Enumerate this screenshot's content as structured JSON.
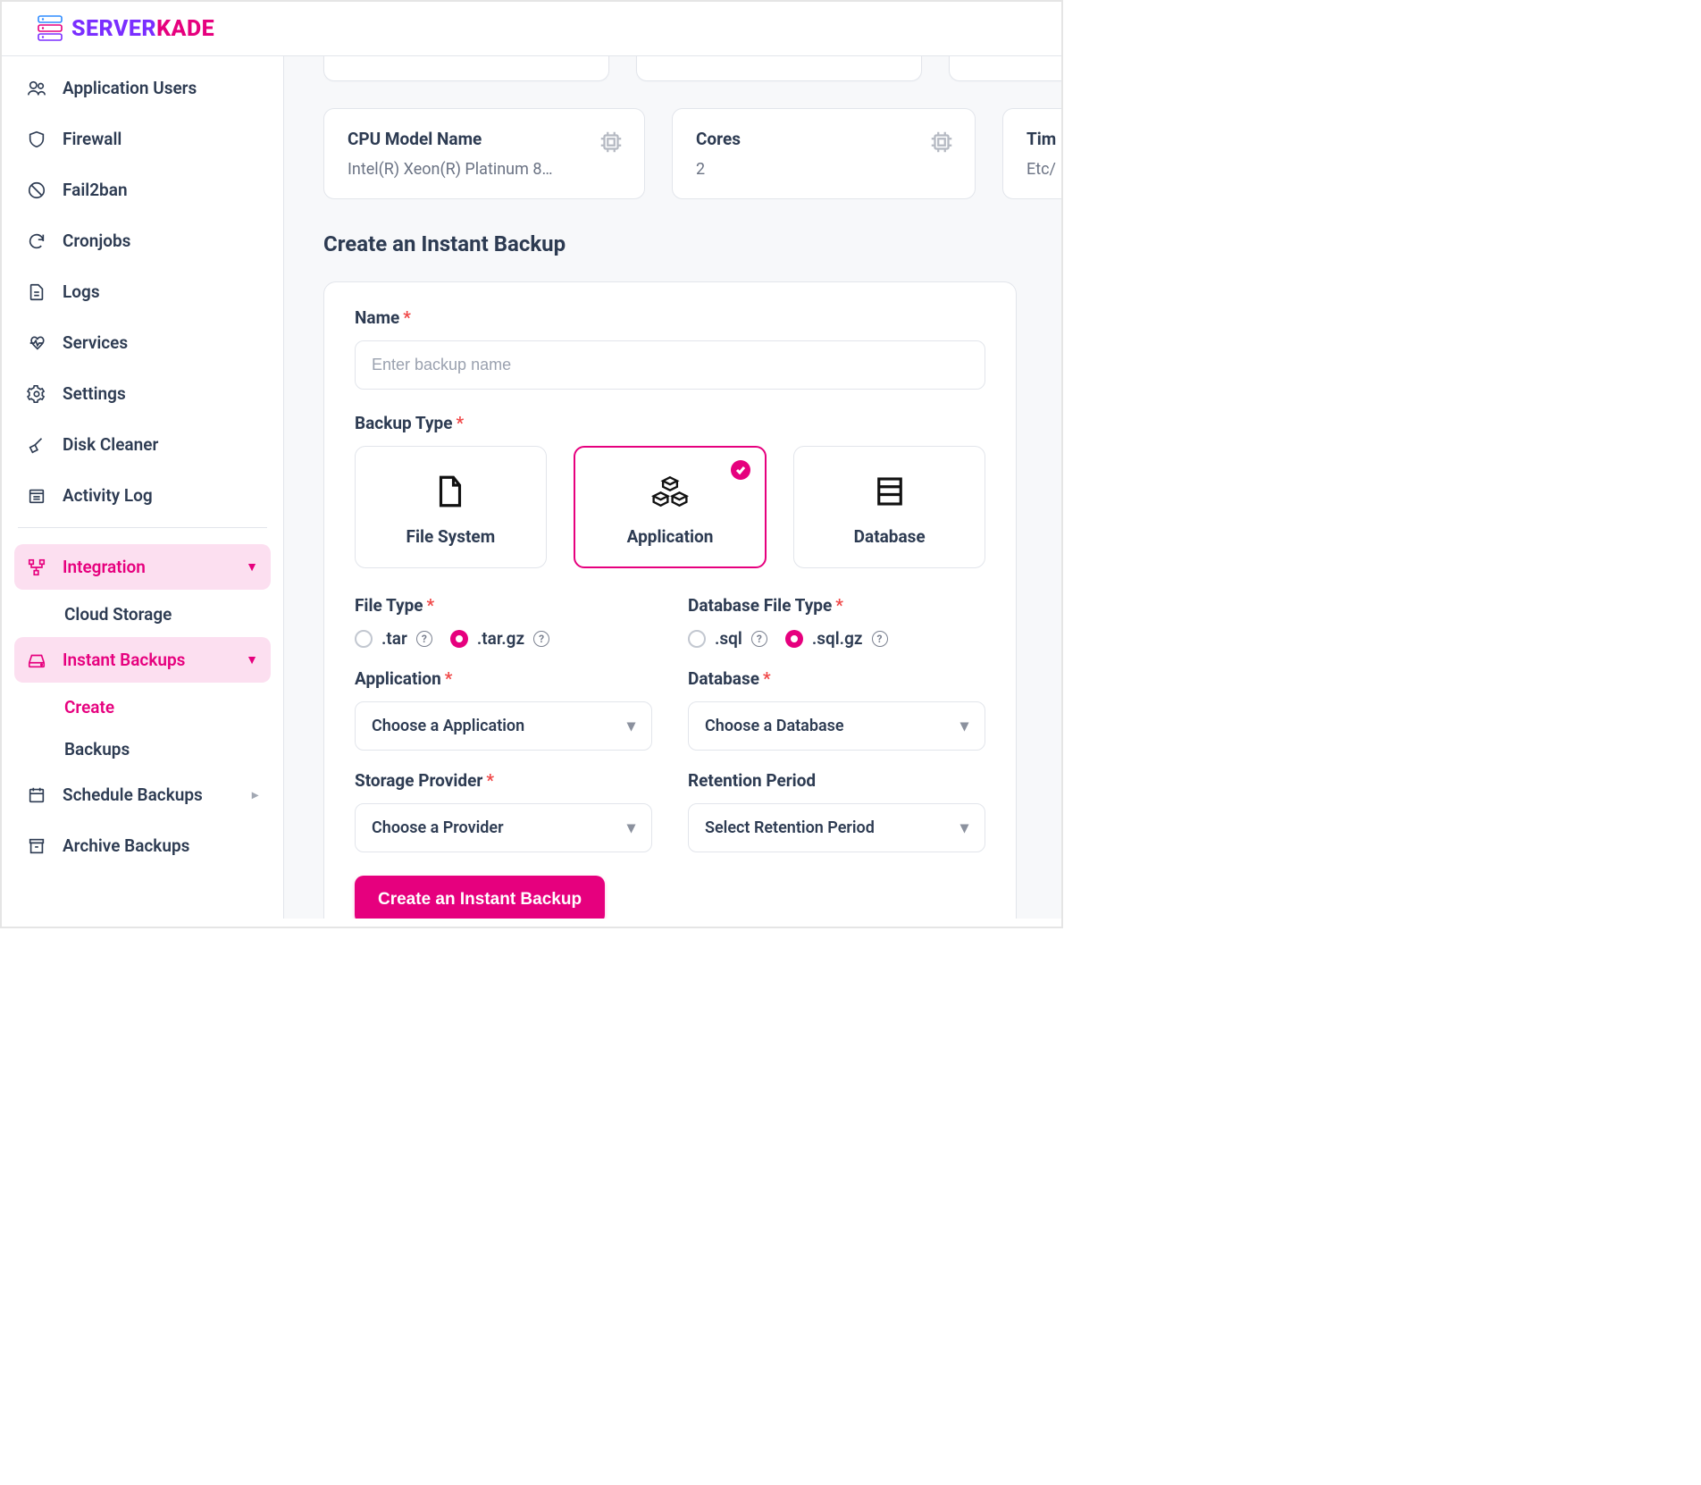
{
  "brand": {
    "part1": "SERVER",
    "part2": "KADE"
  },
  "sidebar": {
    "items": [
      {
        "label": "Application Users",
        "icon": "users"
      },
      {
        "label": "Firewall",
        "icon": "shield"
      },
      {
        "label": "Fail2ban",
        "icon": "ban"
      },
      {
        "label": "Cronjobs",
        "icon": "refresh"
      },
      {
        "label": "Logs",
        "icon": "file"
      },
      {
        "label": "Services",
        "icon": "heart"
      },
      {
        "label": "Settings",
        "icon": "gear"
      },
      {
        "label": "Disk Cleaner",
        "icon": "broom"
      },
      {
        "label": "Activity Log",
        "icon": "calendar"
      }
    ],
    "integration": {
      "label": "Integration",
      "sub": "Cloud Storage"
    },
    "instant_backups": {
      "label": "Instant Backups",
      "sub_create": "Create",
      "sub_backups": "Backups"
    },
    "schedule": {
      "label": "Schedule Backups"
    },
    "archive": {
      "label": "Archive Backups"
    }
  },
  "cards": {
    "cpu": {
      "title": "CPU Model Name",
      "value": "Intel(R) Xeon(R) Platinum 8…"
    },
    "cores": {
      "title": "Cores",
      "value": "2"
    },
    "tz": {
      "title": "Tim",
      "value": "Etc/"
    }
  },
  "page": {
    "title": "Create an Instant Backup"
  },
  "form": {
    "name_label": "Name",
    "name_placeholder": "Enter backup name",
    "type_label": "Backup Type",
    "types": {
      "fs": "File System",
      "app": "Application",
      "db": "Database"
    },
    "file_type_label": "File Type",
    "file_type_opts": {
      "tar": ".tar",
      "targz": ".tar.gz"
    },
    "db_file_type_label": "Database File Type",
    "db_file_type_opts": {
      "sql": ".sql",
      "sqlgz": ".sql.gz"
    },
    "application_label": "Application",
    "application_placeholder": "Choose a Application",
    "database_label": "Database",
    "database_placeholder": "Choose a Database",
    "storage_label": "Storage Provider",
    "storage_placeholder": "Choose a Provider",
    "retention_label": "Retention Period",
    "retention_placeholder": "Select Retention Period",
    "submit": "Create an Instant Backup"
  }
}
